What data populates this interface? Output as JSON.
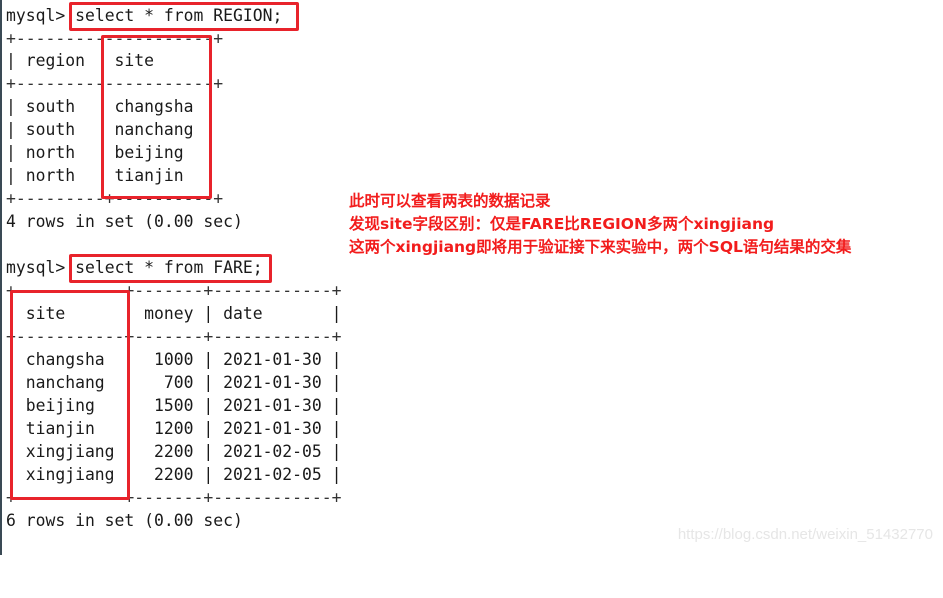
{
  "terminal": {
    "prompt": "mysql>",
    "query1": {
      "command": "select * from REGION;",
      "border_top": "+--------------------+",
      "header_line": "| region   site",
      "border_mid": "+--------------------+",
      "columns": [
        "region",
        "site"
      ],
      "rows": [
        {
          "region": "south",
          "site": "changsha",
          "line": "| south    changsha"
        },
        {
          "region": "south",
          "site": "nanchang",
          "line": "| south    nanchang"
        },
        {
          "region": "north",
          "site": "beijing",
          "line": "| north    beijing"
        },
        {
          "region": "north",
          "site": "tianjin",
          "line": "| north    tianjin"
        }
      ],
      "border_bottom": "+---------+----------+",
      "result": "4 rows in set (0.00 sec)"
    },
    "query2": {
      "command": "select * from FARE;",
      "border_top": "+-----------+-------+------------+",
      "header_line": "  site      | money | date       |",
      "border_mid": "+-----------+-------+------------+",
      "columns": [
        "site",
        "money",
        "date"
      ],
      "rows": [
        {
          "site": "changsha",
          "money": "1000",
          "date": "2021-01-30",
          "line": "  changsha  |  1000 | 2021-01-30 |"
        },
        {
          "site": "nanchang",
          "money": "700",
          "date": "2021-01-30",
          "line": "  nanchang  |   700 | 2021-01-30 |"
        },
        {
          "site": "beijing",
          "money": "1500",
          "date": "2021-01-30",
          "line": "  beijing   |  1500 | 2021-01-30 |"
        },
        {
          "site": "tianjin",
          "money": "1200",
          "date": "2021-01-30",
          "line": "  tianjin   |  1200 | 2021-01-30 |"
        },
        {
          "site": "xingjiang",
          "money": "2200",
          "date": "2021-02-05",
          "line": "  xingjiang |  2200 | 2021-02-05 |"
        },
        {
          "site": "xingjiang",
          "money": "2200",
          "date": "2021-02-05",
          "line": "  xingjiang |  2200 | 2021-02-05 |"
        }
      ],
      "border_bottom": "+-----------+-------+------------+",
      "result": "6 rows in set (0.00 sec)"
    }
  },
  "annotation": {
    "color": "#f21c1c",
    "lines": [
      "此时可以查看两表的数据记录",
      "发现site字段区别：仅是FARE比REGION多两个xingjiang",
      "这两个xingjiang即将用于验证接下来实验中，两个SQL语句结果的交集"
    ]
  },
  "watermark": "https://blog.csdn.net/weixin_51432770"
}
